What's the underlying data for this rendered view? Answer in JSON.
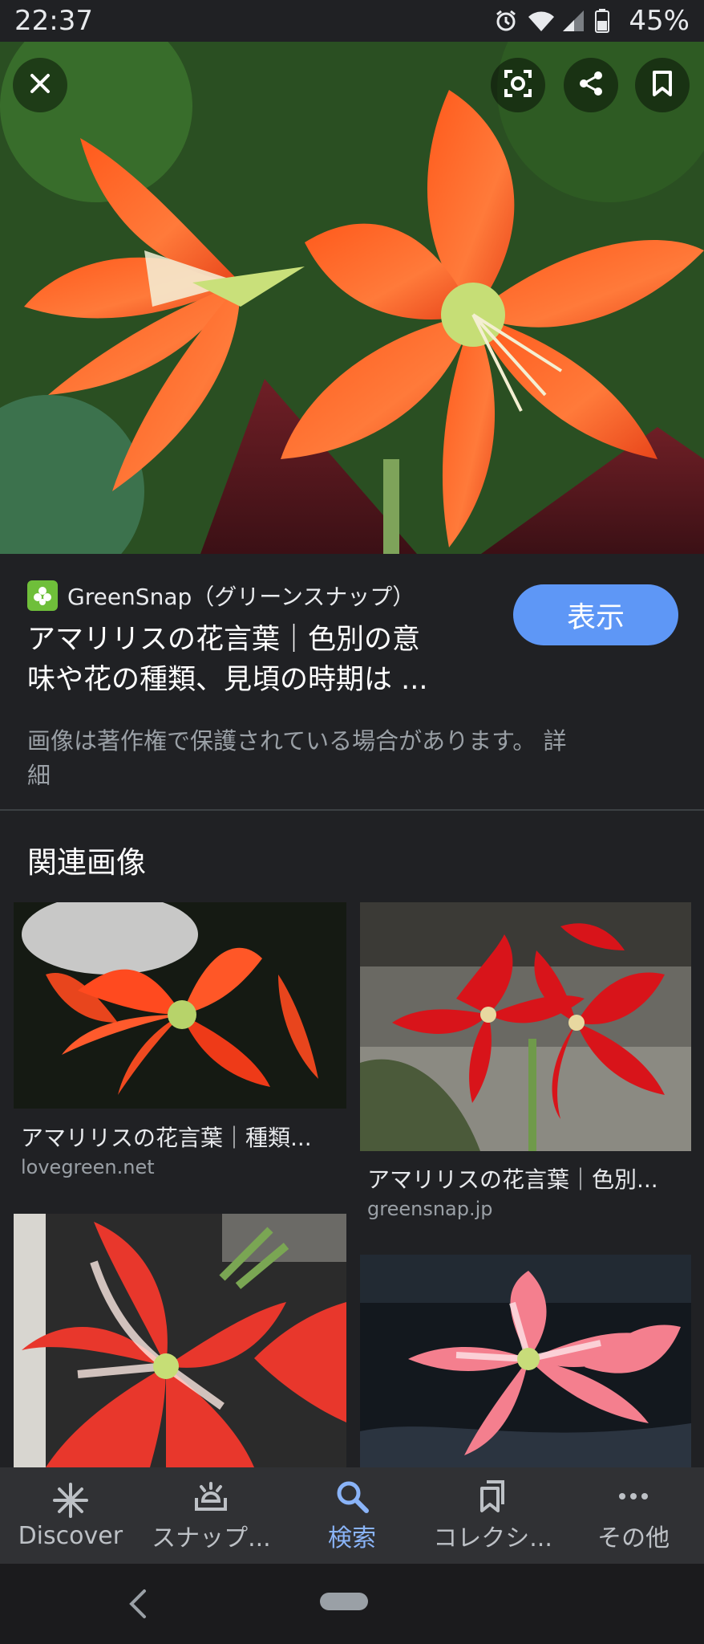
{
  "status_bar": {
    "time": "22:37",
    "battery": "45%"
  },
  "hero": {
    "close_icon": "close-icon",
    "lens_icon": "lens-icon",
    "share_icon": "share-icon",
    "bookmark_icon": "bookmark-icon"
  },
  "result": {
    "source_name": "GreenSnap（グリーンスナップ）",
    "title_line1": "アマリリスの花言葉｜色別の意",
    "title_line2": "味や花の種類、見頃の時期は ...",
    "view_label": "表示",
    "copyright_line1": "画像は著作権で保護されている場合があります。 詳",
    "copyright_line2": "細"
  },
  "related": {
    "heading": "関連画像",
    "items": [
      {
        "title": "アマリリスの花言葉｜種類...",
        "domain": "lovegreen.net"
      },
      {
        "title": "アマリリスの花言葉｜色別...",
        "domain": "greensnap.jp"
      },
      {
        "title": "",
        "domain": ""
      },
      {
        "title": "",
        "domain": ""
      }
    ]
  },
  "bottom_nav": {
    "items": [
      {
        "label": "Discover",
        "icon": "asterisk-icon"
      },
      {
        "label": "スナップ...",
        "icon": "snap-icon"
      },
      {
        "label": "検索",
        "icon": "search-icon"
      },
      {
        "label": "コレクシ...",
        "icon": "collections-icon"
      },
      {
        "label": "その他",
        "icon": "more-icon"
      }
    ],
    "active_index": 2,
    "active_color": "#8ab4f8"
  },
  "colors": {
    "background": "#202124",
    "accent_button": "#5e97f6"
  }
}
